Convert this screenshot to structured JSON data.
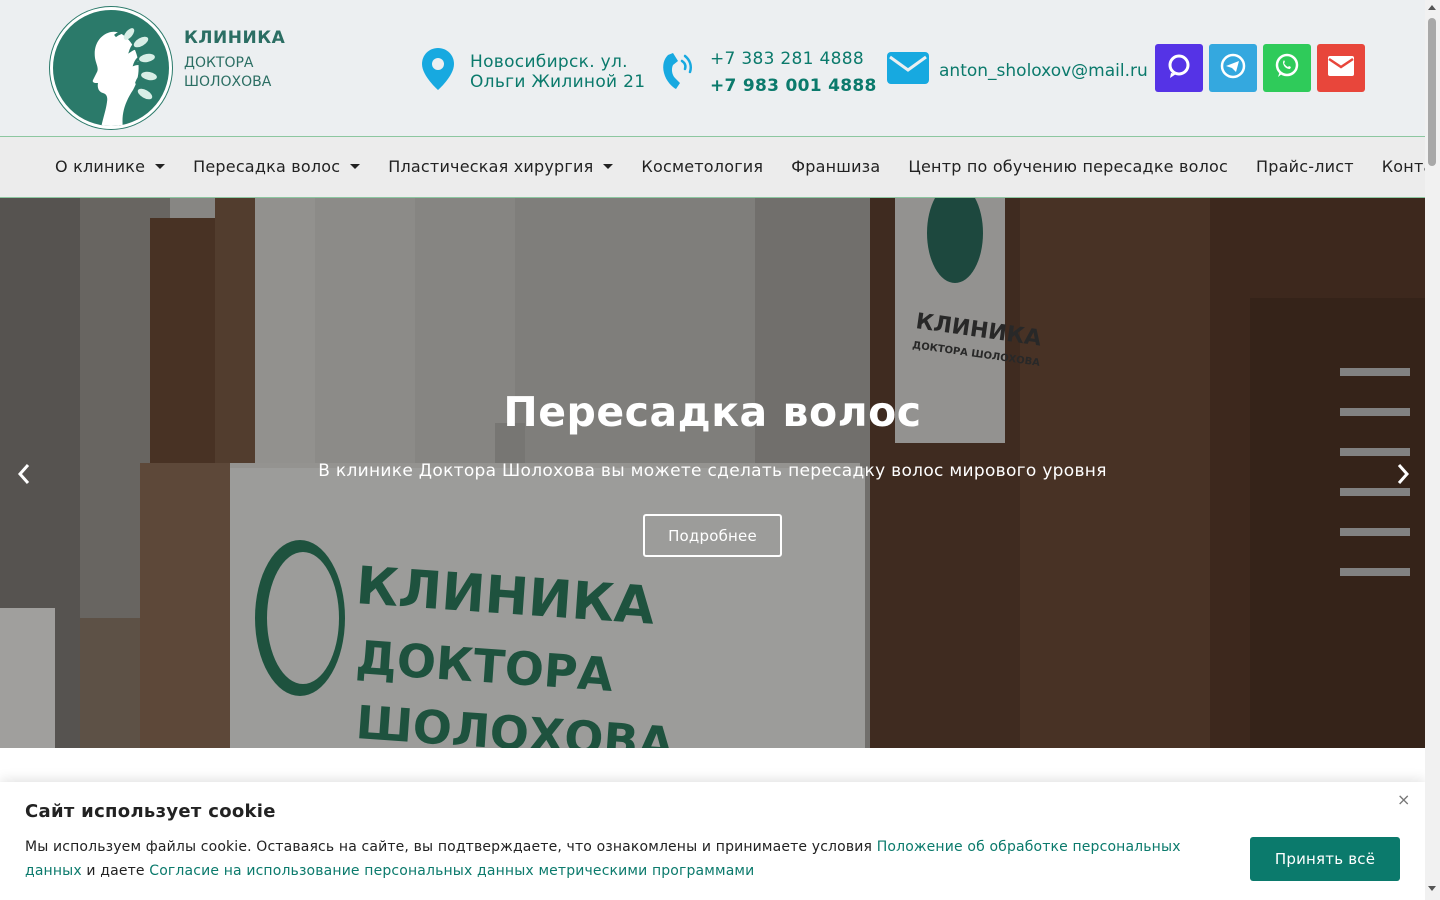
{
  "logo": {
    "line1": "КЛИНИКА",
    "line2": "ДОКТОРА",
    "line3": "ШОЛОХОВА",
    "icon": "woman-profile-leaves-logo"
  },
  "contacts": {
    "address_line1": "Новосибирск. ул.",
    "address_line2": "Ольги Жилиной 21",
    "phone1": "+7 383 281 4888",
    "phone2": "+7 983 001 4888",
    "email": "anton_sholoxov@mail.ru",
    "address_icon": "map-pin-icon",
    "phone_icon": "phone-icon",
    "email_icon": "envelope-icon"
  },
  "socials": [
    {
      "name": "max",
      "icon": "chat-bubble-icon",
      "color": "#5533e6"
    },
    {
      "name": "telegram",
      "icon": "telegram-icon",
      "color": "#34a8df"
    },
    {
      "name": "whatsapp",
      "icon": "whatsapp-icon",
      "color": "#2fcb5a"
    },
    {
      "name": "email",
      "icon": "envelope-icon",
      "color": "#e8463b"
    }
  ],
  "nav": {
    "items": [
      {
        "label": "О клинике",
        "dropdown": true
      },
      {
        "label": "Пересадка волос",
        "dropdown": true
      },
      {
        "label": "Пластическая хирургия",
        "dropdown": true
      },
      {
        "label": "Косметология",
        "dropdown": false
      },
      {
        "label": "Франшиза",
        "dropdown": false
      },
      {
        "label": "Центр по обучению пересадке волос",
        "dropdown": false
      },
      {
        "label": "Прайс-лист",
        "dropdown": false
      },
      {
        "label": "Контакты",
        "dropdown": false
      }
    ]
  },
  "hero": {
    "title": "Пересадка волос",
    "subtitle": "В клинике Доктора Шолохова вы можете сделать пересадку волос мирового уровня",
    "button": "Подробнее",
    "sign_text_1": "КЛИНИКА",
    "sign_text_2": "ДОКТОРА",
    "sign_text_3": "ШОЛОХОВА",
    "wall_text_1": "КЛИНИКА",
    "wall_text_2": "ДОКТОРА ШОЛОХОВА"
  },
  "cookie": {
    "title": "Сайт использует cookie",
    "text_before": "Мы используем файлы cookie. Оставаясь на сайте, вы подтверждаете, что ознакомлены и принимаете условия ",
    "link1": "Положение об обработке персональных данных",
    "text_middle": " и даете ",
    "link2": "Согласие на использование персональных данных метрическими программами",
    "accept": "Принять всё",
    "close": "×"
  },
  "colors": {
    "brand": "#0b7a6c",
    "logo_green": "#2b7a6a",
    "header_bg": "#eceff1"
  }
}
